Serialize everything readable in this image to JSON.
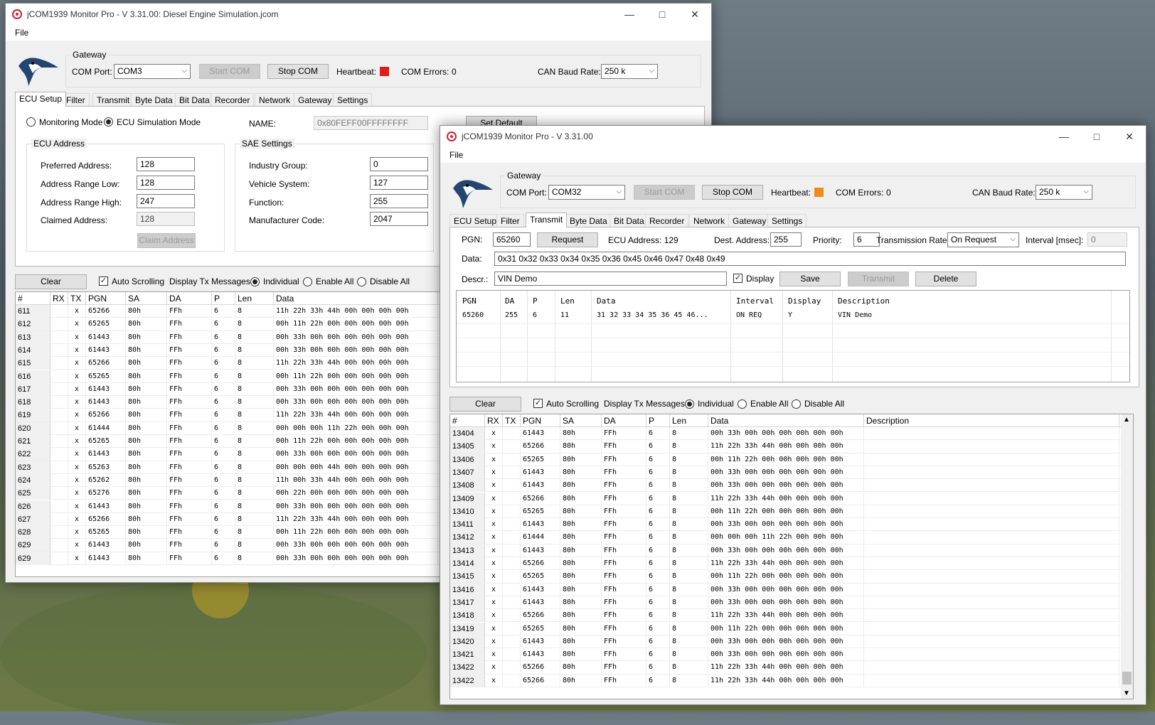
{
  "win1": {
    "title": "jCOM1939 Monitor Pro - V 3.31.00: Diesel Engine Simulation.jcom",
    "menu_file": "File",
    "gateway_label": "Gateway",
    "com_port_label": "COM Port:",
    "com_port_value": "COM3",
    "start_com": "Start COM",
    "stop_com": "Stop COM",
    "heartbeat_label": "Heartbeat:",
    "heartbeat_color": "#e01b1b",
    "com_errors_label": "COM Errors:",
    "com_errors_value": "0",
    "baud_label": "CAN Baud Rate:",
    "baud_value": "250 k",
    "tabs": [
      "ECU Setup",
      "Filter",
      "Transmit",
      "Byte Data",
      "Bit Data",
      "Recorder",
      "Network",
      "Gateway",
      "Settings"
    ],
    "monitoring_mode": "Monitoring Mode",
    "ecu_sim_mode": "ECU Simulation Mode",
    "name_label": "NAME:",
    "name_value": "0x80FEFF00FFFFFFFF",
    "set_default": "Set Default",
    "ecu_address_title": "ECU Address",
    "preferred_label": "Preferred Address:",
    "preferred_value": "128",
    "range_low_label": "Address Range Low:",
    "range_low_value": "128",
    "range_high_label": "Address Range High:",
    "range_high_value": "247",
    "claimed_label": "Claimed Address:",
    "claimed_value": "128",
    "claim_button": "Claim Address",
    "sae_title": "SAE Settings",
    "industry_label": "Industry Group:",
    "industry_value": "0",
    "vehicle_label": "Vehicle System:",
    "vehicle_value": "127",
    "function_label": "Function:",
    "function_value": "255",
    "manufacturer_label": "Manufacturer Code:",
    "manufacturer_value": "2047",
    "clear": "Clear",
    "auto_scroll": "Auto Scrolling",
    "display_tx": "Display Tx Messages:",
    "individual": "Individual",
    "enable_all": "Enable All",
    "disable_all": "Disable All",
    "columns": [
      "#",
      "RX",
      "TX",
      "PGN",
      "SA",
      "DA",
      "P",
      "Len",
      "Data"
    ],
    "rows": [
      [
        "611",
        "",
        "x",
        "65266",
        "80h",
        "FFh",
        "6",
        "8",
        "11h 22h 33h 44h 00h 00h 00h 00h"
      ],
      [
        "612",
        "",
        "x",
        "65265",
        "80h",
        "FFh",
        "6",
        "8",
        "00h 11h 22h 00h 00h 00h 00h 00h"
      ],
      [
        "613",
        "",
        "x",
        "61443",
        "80h",
        "FFh",
        "6",
        "8",
        "00h 33h 00h 00h 00h 00h 00h 00h"
      ],
      [
        "614",
        "",
        "x",
        "61443",
        "80h",
        "FFh",
        "6",
        "8",
        "00h 33h 00h 00h 00h 00h 00h 00h"
      ],
      [
        "615",
        "",
        "x",
        "65266",
        "80h",
        "FFh",
        "6",
        "8",
        "11h 22h 33h 44h 00h 00h 00h 00h"
      ],
      [
        "616",
        "",
        "x",
        "65265",
        "80h",
        "FFh",
        "6",
        "8",
        "00h 11h 22h 00h 00h 00h 00h 00h"
      ],
      [
        "617",
        "",
        "x",
        "61443",
        "80h",
        "FFh",
        "6",
        "8",
        "00h 33h 00h 00h 00h 00h 00h 00h"
      ],
      [
        "618",
        "",
        "x",
        "61443",
        "80h",
        "FFh",
        "6",
        "8",
        "00h 33h 00h 00h 00h 00h 00h 00h"
      ],
      [
        "619",
        "",
        "x",
        "65266",
        "80h",
        "FFh",
        "6",
        "8",
        "11h 22h 33h 44h 00h 00h 00h 00h"
      ],
      [
        "620",
        "",
        "x",
        "61444",
        "80h",
        "FFh",
        "6",
        "8",
        "00h 00h 00h 11h 22h 00h 00h 00h"
      ],
      [
        "621",
        "",
        "x",
        "65265",
        "80h",
        "FFh",
        "6",
        "8",
        "00h 11h 22h 00h 00h 00h 00h 00h"
      ],
      [
        "622",
        "",
        "x",
        "61443",
        "80h",
        "FFh",
        "6",
        "8",
        "00h 33h 00h 00h 00h 00h 00h 00h"
      ],
      [
        "623",
        "",
        "x",
        "65263",
        "80h",
        "FFh",
        "6",
        "8",
        "00h 00h 00h 44h 00h 00h 00h 00h"
      ],
      [
        "624",
        "",
        "x",
        "65262",
        "80h",
        "FFh",
        "6",
        "8",
        "11h 00h 33h 44h 00h 00h 00h 00h"
      ],
      [
        "625",
        "",
        "x",
        "65276",
        "80h",
        "FFh",
        "6",
        "8",
        "00h 22h 00h 00h 00h 00h 00h 00h"
      ],
      [
        "626",
        "",
        "x",
        "61443",
        "80h",
        "FFh",
        "6",
        "8",
        "00h 33h 00h 00h 00h 00h 00h 00h"
      ],
      [
        "627",
        "",
        "x",
        "65266",
        "80h",
        "FFh",
        "6",
        "8",
        "11h 22h 33h 44h 00h 00h 00h 00h"
      ],
      [
        "628",
        "",
        "x",
        "65265",
        "80h",
        "FFh",
        "6",
        "8",
        "00h 11h 22h 00h 00h 00h 00h 00h"
      ],
      [
        "629",
        "",
        "x",
        "61443",
        "80h",
        "FFh",
        "6",
        "8",
        "00h 33h 00h 00h 00h 00h 00h 00h"
      ],
      [
        "629",
        "",
        "x",
        "61443",
        "80h",
        "FFh",
        "6",
        "8",
        "00h 33h 00h 00h 00h 00h 00h 00h"
      ]
    ]
  },
  "win2": {
    "title": "jCOM1939 Monitor Pro - V 3.31.00",
    "menu_file": "File",
    "gateway_label": "Gateway",
    "com_port_label": "COM Port:",
    "com_port_value": "COM32",
    "start_com": "Start COM",
    "stop_com": "Stop COM",
    "heartbeat_label": "Heartbeat:",
    "heartbeat_color": "#f08a1c",
    "com_errors_label": "COM Errors:",
    "com_errors_value": "0",
    "baud_label": "CAN Baud Rate:",
    "baud_value": "250 k",
    "tabs": [
      "ECU Setup",
      "Filter",
      "Transmit",
      "Byte Data",
      "Bit Data",
      "Recorder",
      "Network",
      "Gateway",
      "Settings"
    ],
    "pgn_label": "PGN:",
    "pgn_value": "65260",
    "request": "Request",
    "ecu_address": "ECU Address: 129",
    "dest_label": "Dest. Address:",
    "dest_value": "255",
    "priority_label": "Priority:",
    "priority_value": "6",
    "trans_rate_label": "Transmission Rate:",
    "trans_rate_value": "On Request",
    "interval_label": "Interval [msec]:",
    "interval_value": "0",
    "data_label": "Data:",
    "data_value": "0x31 0x32 0x33 0x34 0x35 0x36 0x45 0x46 0x47 0x48 0x49",
    "descr_label": "Descr.:",
    "descr_value": "VIN Demo",
    "display_label": "Display",
    "save": "Save",
    "transmit": "Transmit",
    "delete": "Delete",
    "tx_columns": [
      "PGN",
      "DA",
      "P",
      "Len",
      "Data",
      "Interval",
      "Display",
      "Description"
    ],
    "tx_row": [
      "65260",
      "255",
      "6",
      "11",
      "31 32 33 34 35 36 45 46...",
      "ON REQ",
      "Y",
      "VIN Demo"
    ],
    "clear": "Clear",
    "auto_scroll": "Auto Scrolling",
    "display_tx": "Display Tx Messages:",
    "individual": "Individual",
    "enable_all": "Enable All",
    "disable_all": "Disable All",
    "columns": [
      "#",
      "RX",
      "TX",
      "PGN",
      "SA",
      "DA",
      "P",
      "Len",
      "Data",
      "Description"
    ],
    "rows": [
      [
        "13404",
        "x",
        "",
        "61443",
        "80h",
        "FFh",
        "6",
        "8",
        "00h 33h 00h 00h 00h 00h 00h 00h",
        ""
      ],
      [
        "13405",
        "x",
        "",
        "65266",
        "80h",
        "FFh",
        "6",
        "8",
        "11h 22h 33h 44h 00h 00h 00h 00h",
        ""
      ],
      [
        "13406",
        "x",
        "",
        "65265",
        "80h",
        "FFh",
        "6",
        "8",
        "00h 11h 22h 00h 00h 00h 00h 00h",
        ""
      ],
      [
        "13407",
        "x",
        "",
        "61443",
        "80h",
        "FFh",
        "6",
        "8",
        "00h 33h 00h 00h 00h 00h 00h 00h",
        ""
      ],
      [
        "13408",
        "x",
        "",
        "61443",
        "80h",
        "FFh",
        "6",
        "8",
        "00h 33h 00h 00h 00h 00h 00h 00h",
        ""
      ],
      [
        "13409",
        "x",
        "",
        "65266",
        "80h",
        "FFh",
        "6",
        "8",
        "11h 22h 33h 44h 00h 00h 00h 00h",
        ""
      ],
      [
        "13410",
        "x",
        "",
        "65265",
        "80h",
        "FFh",
        "6",
        "8",
        "00h 11h 22h 00h 00h 00h 00h 00h",
        ""
      ],
      [
        "13411",
        "x",
        "",
        "61443",
        "80h",
        "FFh",
        "6",
        "8",
        "00h 33h 00h 00h 00h 00h 00h 00h",
        ""
      ],
      [
        "13412",
        "x",
        "",
        "61444",
        "80h",
        "FFh",
        "6",
        "8",
        "00h 00h 00h 11h 22h 00h 00h 00h",
        ""
      ],
      [
        "13413",
        "x",
        "",
        "61443",
        "80h",
        "FFh",
        "6",
        "8",
        "00h 33h 00h 00h 00h 00h 00h 00h",
        ""
      ],
      [
        "13414",
        "x",
        "",
        "65266",
        "80h",
        "FFh",
        "6",
        "8",
        "11h 22h 33h 44h 00h 00h 00h 00h",
        ""
      ],
      [
        "13415",
        "x",
        "",
        "65265",
        "80h",
        "FFh",
        "6",
        "8",
        "00h 11h 22h 00h 00h 00h 00h 00h",
        ""
      ],
      [
        "13416",
        "x",
        "",
        "61443",
        "80h",
        "FFh",
        "6",
        "8",
        "00h 33h 00h 00h 00h 00h 00h 00h",
        ""
      ],
      [
        "13417",
        "x",
        "",
        "61443",
        "80h",
        "FFh",
        "6",
        "8",
        "00h 33h 00h 00h 00h 00h 00h 00h",
        ""
      ],
      [
        "13418",
        "x",
        "",
        "65266",
        "80h",
        "FFh",
        "6",
        "8",
        "11h 22h 33h 44h 00h 00h 00h 00h",
        ""
      ],
      [
        "13419",
        "x",
        "",
        "65265",
        "80h",
        "FFh",
        "6",
        "8",
        "00h 11h 22h 00h 00h 00h 00h 00h",
        ""
      ],
      [
        "13420",
        "x",
        "",
        "61443",
        "80h",
        "FFh",
        "6",
        "8",
        "00h 33h 00h 00h 00h 00h 00h 00h",
        ""
      ],
      [
        "13421",
        "x",
        "",
        "61443",
        "80h",
        "FFh",
        "6",
        "8",
        "00h 33h 00h 00h 00h 00h 00h 00h",
        ""
      ],
      [
        "13422",
        "x",
        "",
        "65266",
        "80h",
        "FFh",
        "6",
        "8",
        "11h 22h 33h 44h 00h 00h 00h 00h",
        ""
      ],
      [
        "13422",
        "x",
        "",
        "65266",
        "80h",
        "FFh",
        "6",
        "8",
        "11h 22h 33h 44h 00h 00h 00h 00h",
        ""
      ]
    ]
  }
}
